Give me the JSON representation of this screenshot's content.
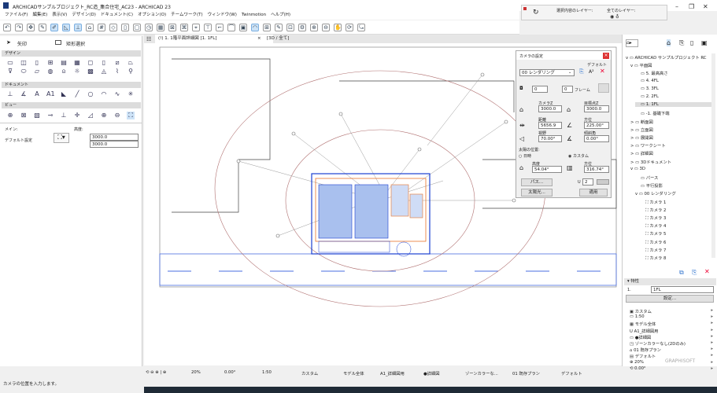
{
  "window": {
    "title": "ARCHICADサンプルプロジェクト_RC造_集合住宅_AC23 - ARCHICAD 23",
    "minimize": "–",
    "restore": "❐",
    "close": "✕"
  },
  "menu": [
    "ファイル(F)",
    "編集(E)",
    "表示(V)",
    "デザイン(D)",
    "ドキュメント(C)",
    "オプション(O)",
    "チームワーク(T)",
    "ウィンドウ(W)",
    "Twinmotion",
    "ヘルプ(H)"
  ],
  "layers": {
    "selected_label": "選択内容のレイヤー:",
    "all_label": "全てのレイヤー:"
  },
  "tabs": [
    {
      "label": "(!) 1. 1階平面詳細図 [1. 1FL]",
      "close": "×"
    },
    {
      "label": "[3D / 全て]"
    }
  ],
  "toolbox": {
    "arrow": "矢印",
    "marquee": "矩形選択",
    "sections": [
      "デザイン",
      "ドキュメント",
      "ビュー"
    ],
    "info": {
      "main_label": "メイン:",
      "default_label": "デフォルト設定",
      "height_label": "高度:",
      "value1": "3000.0",
      "value2": "3000.0"
    }
  },
  "camera_dialog": {
    "title": "カメラの設定",
    "default": "デフォルト",
    "preset": "00 レンダリング",
    "frame_value1": "0",
    "frame_value2": "0",
    "frame_label": "フレーム",
    "camera_z_label": "カメラZ",
    "camera_z": "3000.0",
    "target_z_label": "目標点Z",
    "target_z": "3000.0",
    "distance_label": "距離",
    "distance": "5656.9",
    "azimuth_label": "方位",
    "azimuth": "225.00°",
    "fov_label": "視野",
    "fov": "70.00°",
    "roll_label": "傾斜角",
    "roll": "0.00°",
    "sun_label": "太陽の位置:",
    "sun_option_datetime": "日時",
    "sun_option_custom": "カスタム",
    "sun_selected": "カスタム",
    "altitude_label": "高度",
    "altitude": "54.04°",
    "sun_azimuth_label": "方位",
    "sun_azimuth": "316.74°",
    "path_button": "パス...",
    "sun_button": "太陽光...",
    "apply_button": "適用",
    "count": "2"
  },
  "navigator": {
    "items": [
      {
        "label": "ARCHICAD サンプルプロジェクト RC",
        "level": 0,
        "exp": "v"
      },
      {
        "label": "平面図",
        "level": 1,
        "exp": "v"
      },
      {
        "label": "5. 最高高さ",
        "level": 2
      },
      {
        "label": "4. 4FL",
        "level": 2
      },
      {
        "label": "3. 3FL",
        "level": 2
      },
      {
        "label": "2. 2FL",
        "level": 2
      },
      {
        "label": "1. 1FL",
        "level": 2,
        "selected": true
      },
      {
        "label": "-1. 基礎下端",
        "level": 2
      },
      {
        "label": "断面図",
        "level": 1,
        "exp": ">"
      },
      {
        "label": "立面図",
        "level": 1,
        "exp": ">"
      },
      {
        "label": "展開図",
        "level": 1,
        "exp": ">"
      },
      {
        "label": "ワークシート",
        "level": 1,
        "exp": ">"
      },
      {
        "label": "詳細図",
        "level": 1,
        "exp": ">"
      },
      {
        "label": "3Dドキュメント",
        "level": 1,
        "exp": ">"
      },
      {
        "label": "3D",
        "level": 1,
        "exp": "v"
      },
      {
        "label": "パース",
        "level": 2
      },
      {
        "label": "平行投影",
        "level": 2
      },
      {
        "label": "00 レンダリング",
        "level": 2,
        "exp": "v"
      },
      {
        "label": "カメラ 1",
        "level": 3
      },
      {
        "label": "カメラ 2",
        "level": 3
      },
      {
        "label": "カメラ 3",
        "level": 3
      },
      {
        "label": "カメラ 4",
        "level": 3
      },
      {
        "label": "カメラ 5",
        "level": 3
      },
      {
        "label": "カメラ 6",
        "level": 3
      },
      {
        "label": "カメラ 7",
        "level": 3
      },
      {
        "label": "カメラ 8",
        "level": 3
      }
    ],
    "properties_header": "特性",
    "prop_id": "1.",
    "prop_name": "1FL",
    "settings_button": "設定...",
    "view_props": [
      "カスタム",
      "1:50",
      "モデル全体",
      "A1_詳細図用",
      "●詳細図",
      "ゾーンカラーなし(2Dのみ)",
      "01 既存プラン",
      "デフォルト",
      "20%",
      "0.00°"
    ],
    "brand": "GRAPHISOFT"
  },
  "statusbar": {
    "zoom": "20%",
    "angle": "0.00°",
    "scale": "1:50",
    "layer": "カスタム",
    "model": "モデル全体",
    "pen": "A1_詳細図用",
    "detail": "●詳細図",
    "zone": "ゾーンカラーな...",
    "reno": "01 既存プラン",
    "dim": "デフォルト"
  },
  "hint": "カメラの位置を入力します。",
  "colors": {
    "accent": "#1a3fd1",
    "plan_orange": "#e8742a",
    "camera_path": "#b07070",
    "selection": "#cde3f7"
  }
}
